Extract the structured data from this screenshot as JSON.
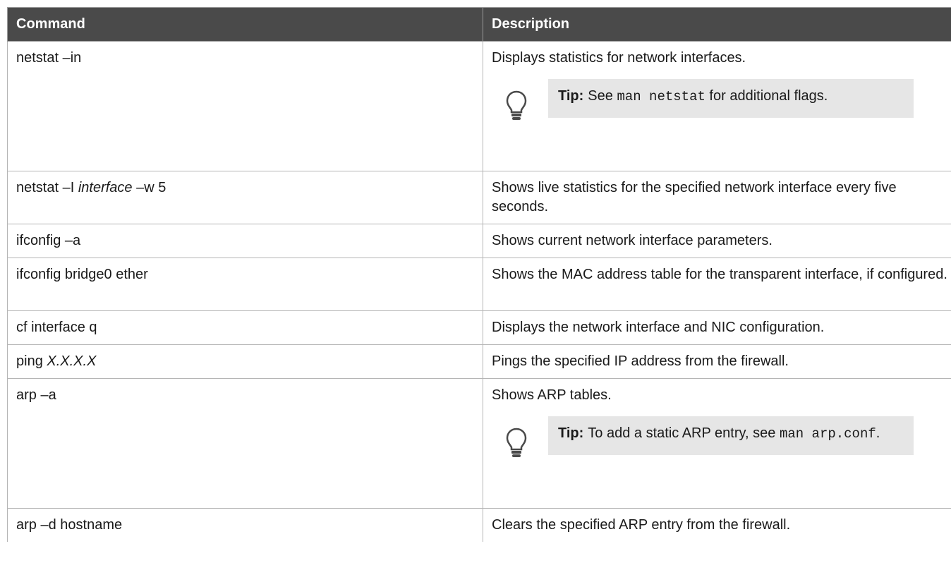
{
  "table": {
    "headers": {
      "command": "Command",
      "description": "Description"
    },
    "rows": [
      {
        "cmd": {
          "a": "netstat –in"
        },
        "desc": "Displays statistics for network interfaces.",
        "tip": {
          "label": "Tip:",
          "t1": "See ",
          "code1": "man netstat",
          "t2": " for additional flags."
        }
      },
      {
        "cmd": {
          "a": "netstat –I ",
          "i": "interface",
          "b": " –w 5"
        },
        "desc": "Shows live statistics for the specified network interface every five seconds."
      },
      {
        "cmd": {
          "a": "ifconfig –a"
        },
        "desc": "Shows current network interface parameters."
      },
      {
        "cmd": {
          "a": "ifconfig bridge0 ether"
        },
        "desc": "Shows the MAC address table for the transparent interface, if configured."
      },
      {
        "cmd": {
          "a": "cf interface q"
        },
        "desc": "Displays the network interface and NIC configuration."
      },
      {
        "cmd": {
          "a": "ping ",
          "i": "X.X.X.X"
        },
        "desc": "Pings the specified IP address from the firewall."
      },
      {
        "cmd": {
          "a": "arp –a"
        },
        "desc": "Shows ARP tables.",
        "tip": {
          "label": "Tip:",
          "t1": "To add a static ARP entry, see ",
          "code1": "man arp.conf",
          "t2": "."
        }
      },
      {
        "cmd": {
          "a": "arp –d hostname"
        },
        "desc": "Clears the specified ARP entry from the firewall."
      }
    ]
  },
  "icons": {
    "tip_icon": "lightbulb-icon"
  }
}
